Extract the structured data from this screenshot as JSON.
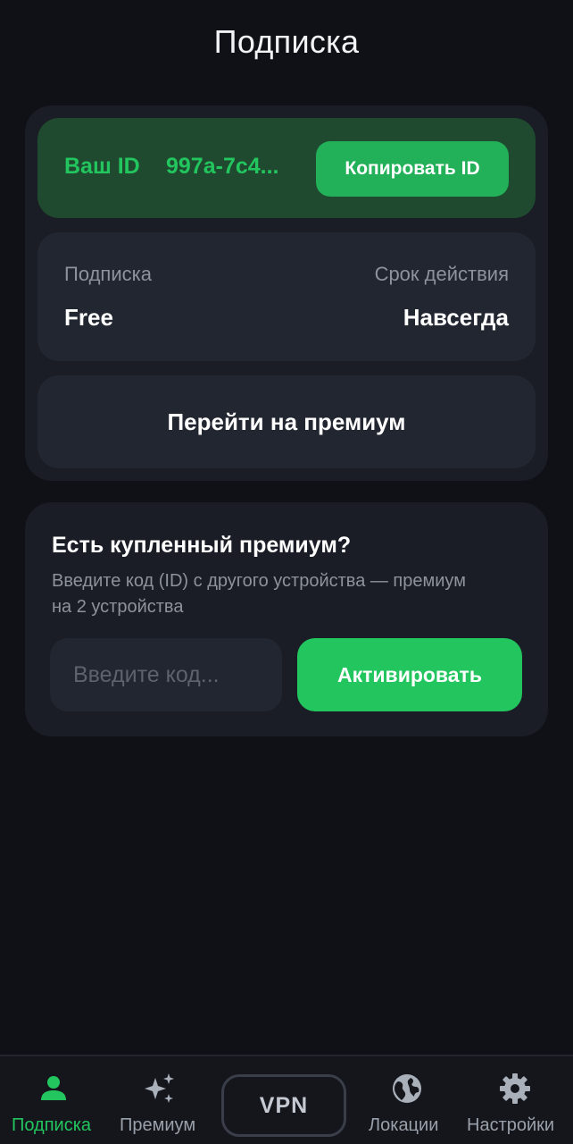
{
  "header": {
    "title": "Подписка"
  },
  "account": {
    "id_label": "Ваш ID",
    "id_value": "997a-7c4...",
    "copy_button": "Копировать ID"
  },
  "subscription": {
    "plan_label": "Подписка",
    "plan_value": "Free",
    "expiry_label": "Срок действия",
    "expiry_value": "Навсегда",
    "upgrade_button": "Перейти на премиум"
  },
  "activation": {
    "title": "Есть купленный премиум?",
    "description": "Введите код (ID) с другого устройства — премиум на 2 устройства",
    "input_placeholder": "Введите код...",
    "activate_button": "Активировать"
  },
  "nav": {
    "items": [
      {
        "label": "Подписка",
        "icon": "person-icon",
        "active": true
      },
      {
        "label": "Премиум",
        "icon": "sparkles-icon",
        "active": false
      },
      {
        "label": "VPN",
        "icon": "",
        "active": false
      },
      {
        "label": "Локации",
        "icon": "globe-icon",
        "active": false
      },
      {
        "label": "Настройки",
        "icon": "gear-icon",
        "active": false
      }
    ]
  },
  "colors": {
    "background": "#0f1117",
    "card": "#1a1d25",
    "accent": "#22c55e",
    "id_row_bg": "#1f4a2f",
    "muted_text": "#8d929c"
  }
}
